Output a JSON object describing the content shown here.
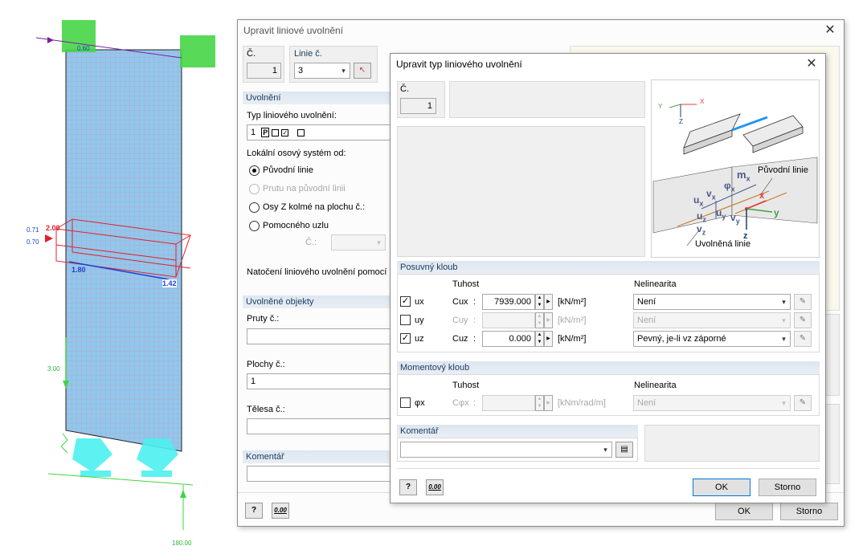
{
  "model": {
    "labels": {
      "top_left": "0.60",
      "red_top": "2.00",
      "left_071": "0.71",
      "left_070": "0.70",
      "bottom_180": "1.80",
      "bottom_142": "1.42",
      "load_300": "3.00",
      "force_18000": "180.00"
    }
  },
  "outer_dialog": {
    "title": "Upravit liniové uvolnění",
    "no_label": "Č.",
    "no_value": "1",
    "line_label": "Linie č.",
    "line_value": "3",
    "release_header": "Uvolnění",
    "type_label": "Typ liniového uvolnění:",
    "type_no": "1",
    "type_code": "P",
    "local_label": "Lokální osový systém od:",
    "radio_original": "Původní linie",
    "radio_member": "Prutu na původní linii",
    "radio_zaxis": "Osy Z kolmé na plochu č.:",
    "radio_helper": "Pomocného uzlu",
    "helper_no_label": "Č.:",
    "rotation_label": "Natočení liniového uvolnění pomocí úh",
    "released_header": "Uvolněné objekty",
    "members_label": "Pruty č.:",
    "surfaces_label": "Plochy č.:",
    "surfaces_value": "1",
    "solids_label": "Tělesa č.:",
    "comment_header": "Komentář",
    "ok_label": "OK",
    "cancel_label": "Storno"
  },
  "inner_dialog": {
    "title": "Upravit typ liniového uvolnění",
    "no_label": "Č.",
    "no_value": "1",
    "diagram": {
      "axis_x": "X",
      "axis_y": "Y",
      "axis_z": "Z",
      "original_line": "Původní linie",
      "released_line": "Uvolněná linie",
      "sym_mx": "m",
      "sub_mx": "x",
      "sym_phix": "φ",
      "sub_phix": "x",
      "sym_vx": "v",
      "sub_vx": "x",
      "sym_ux": "u",
      "sub_ux": "x",
      "sym_vy": "v",
      "sub_vy": "y",
      "sym_uy": "u",
      "sub_uy": "y",
      "sym_uz": "u",
      "sub_uz": "z",
      "sym_vz": "v",
      "sub_vz": "z",
      "loc_x": "x",
      "loc_y": "y",
      "loc_z": "z"
    },
    "sliding_header": "Posuvný kloub",
    "stiffness_header": "Tuhost",
    "nonlinearity_header": "Nelinearita",
    "rows": [
      {
        "label": "ux",
        "c_label": "Cux",
        "value": "7939.000",
        "unit": "[kN/m²]",
        "nonlin": "Není",
        "checked": true,
        "enabled": true
      },
      {
        "label": "uy",
        "c_label": "Cuy",
        "value": "",
        "unit": "[kN/m²]",
        "nonlin": "Není",
        "checked": false,
        "enabled": false
      },
      {
        "label": "uz",
        "c_label": "Cuz",
        "value": "0.000",
        "unit": "[kN/m²]",
        "nonlin": "Pevný, je-li vz záporné",
        "checked": true,
        "enabled": true
      }
    ],
    "colon": ":",
    "moment_header": "Momentový kloub",
    "moment_stiffness_header": "Tuhost",
    "moment_nonlinearity_header": "Nelinearita",
    "moment_row": {
      "label": "φx",
      "c_label": "Cφx",
      "value": "",
      "unit": "[kNm/rad/m]",
      "nonlin": "Není",
      "checked": false
    },
    "comment_header": "Komentář",
    "ok_label": "OK",
    "cancel_label": "Storno",
    "calc_label": "0.00"
  },
  "colors": {
    "surface": "#8fc8ee",
    "support": "#4df0f0",
    "hinge": "#3ed63e",
    "header_text": "#1e3d63",
    "accent": "#0078d7"
  }
}
